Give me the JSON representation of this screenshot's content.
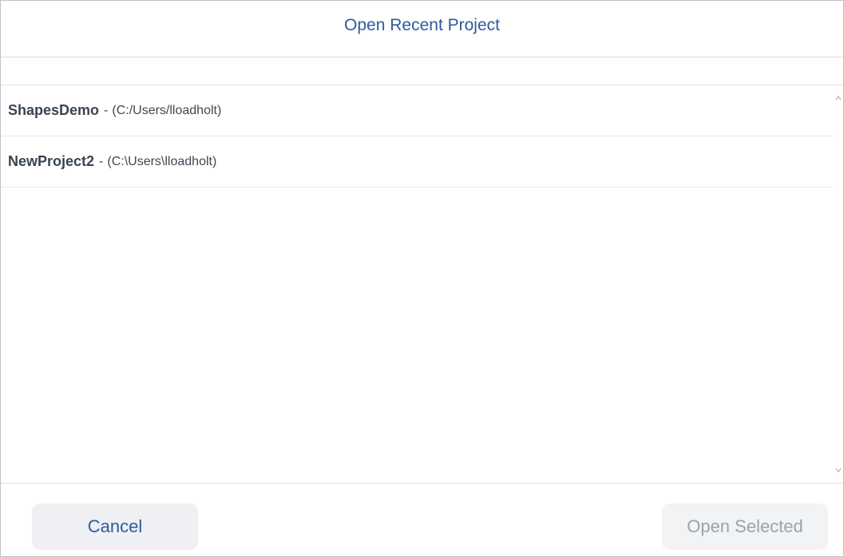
{
  "dialog": {
    "title": "Open Recent Project"
  },
  "projects": [
    {
      "name": "ShapesDemo",
      "separator": "-",
      "path": "(C:/Users/lloadholt)"
    },
    {
      "name": "NewProject2",
      "separator": "-",
      "path": "(C:\\Users\\lloadholt)"
    }
  ],
  "footer": {
    "cancel_label": "Cancel",
    "open_label": "Open Selected"
  },
  "scrollbar": {
    "up_icon": "chevron-up-icon",
    "down_icon": "chevron-down-icon"
  },
  "colors": {
    "accent": "#2f5a9c",
    "disabled_text": "#9aa3ae",
    "button_bg": "#eef0f3"
  }
}
